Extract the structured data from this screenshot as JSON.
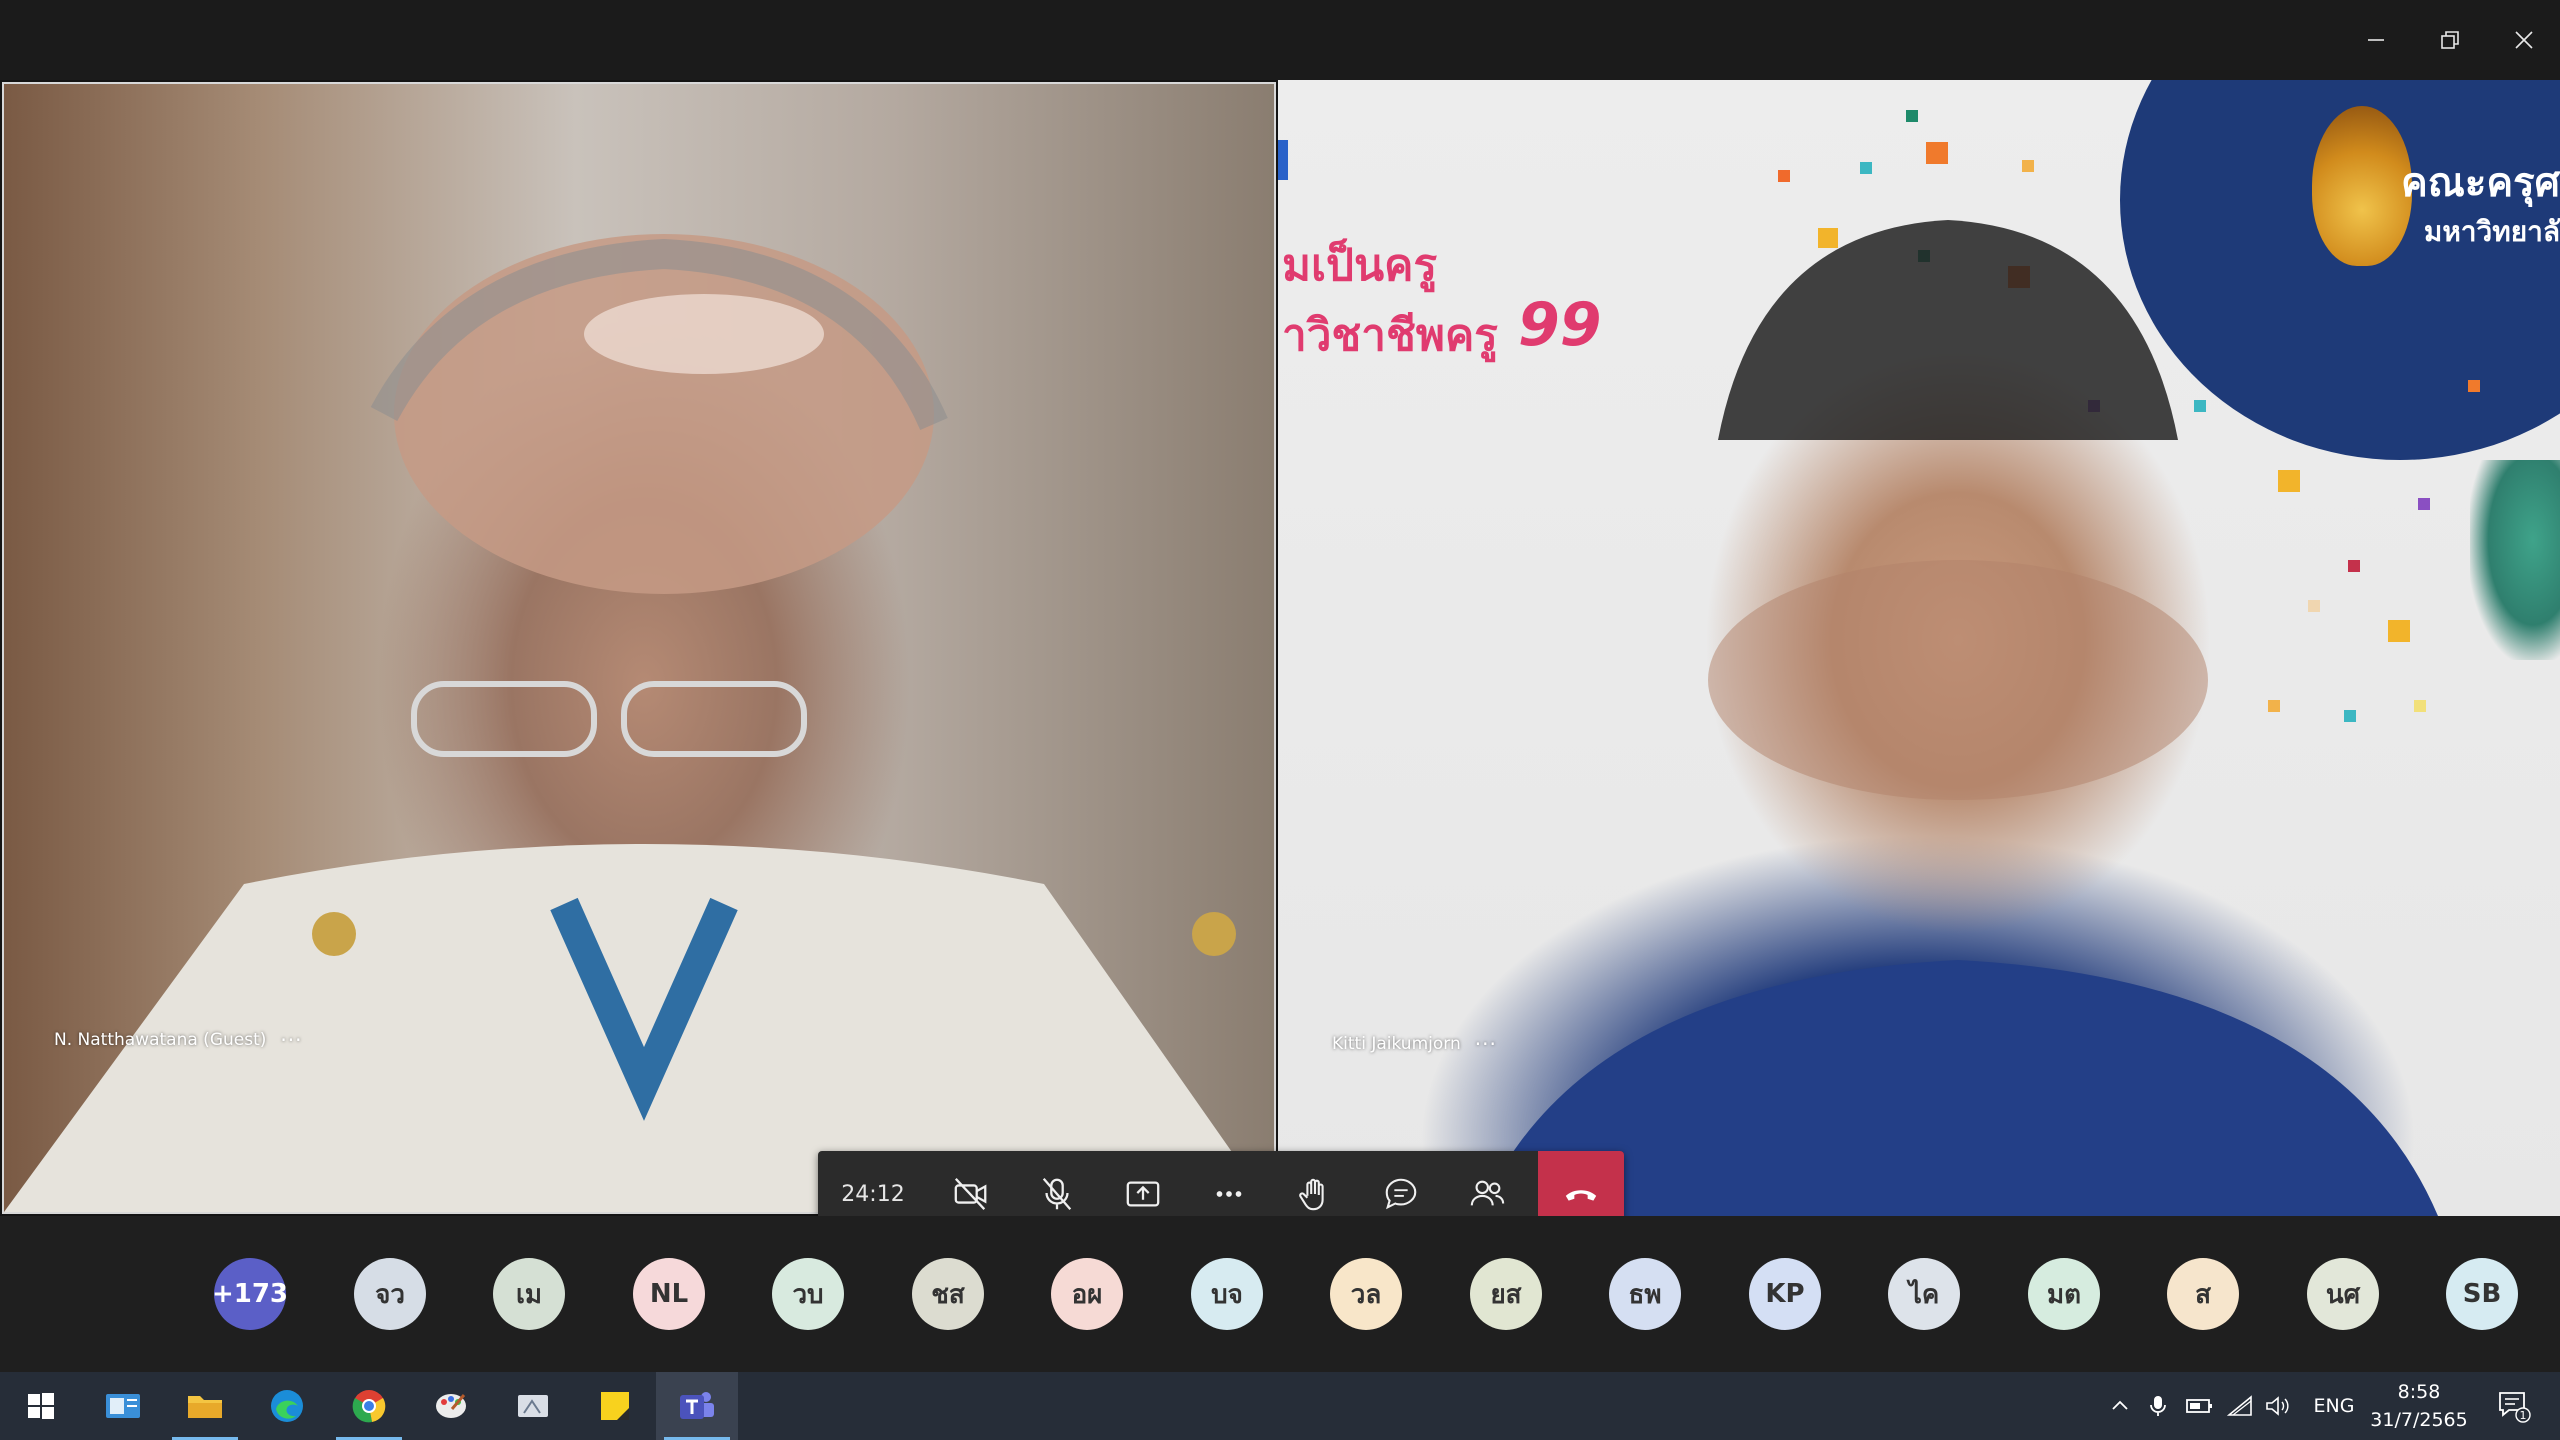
{
  "window": {
    "controls": [
      "minimize",
      "restore",
      "close"
    ]
  },
  "participants_video": [
    {
      "name": "N. Natthawatana (Guest)",
      "more": "···"
    },
    {
      "name": "Kitti Jaikumjorn",
      "more": "···"
    }
  ],
  "background_banner": {
    "line1": "มเป็นครู",
    "line2": "าวิชาชีพครู",
    "quote_mark": "99",
    "logo_line1": "คณะครุศ",
    "logo_line2": "มหาวิทยาลั"
  },
  "call_controls": {
    "timer": "24:12",
    "buttons": [
      "camera-off",
      "mic-off",
      "share-screen",
      "more-actions",
      "raise-hand",
      "chat",
      "participants",
      "leave"
    ]
  },
  "participant_avatars": [
    {
      "initials": "+173",
      "color": "#5b5fc7",
      "text_color": "#ffffff"
    },
    {
      "initials": "จว",
      "color": "#d6dde6"
    },
    {
      "initials": "เม",
      "color": "#d5e0d4"
    },
    {
      "initials": "NL",
      "color": "#f6d9da"
    },
    {
      "initials": "วบ",
      "color": "#d8eadf"
    },
    {
      "initials": "ชส",
      "color": "#dcdcd0"
    },
    {
      "initials": "อผ",
      "color": "#f6dad5"
    },
    {
      "initials": "บจ",
      "color": "#d7ebf1"
    },
    {
      "initials": "วล",
      "color": "#f8e6c9"
    },
    {
      "initials": "ยส",
      "color": "#e1e6d2"
    },
    {
      "initials": "ธพ",
      "color": "#d5dff2"
    },
    {
      "initials": "KP",
      "color": "#d4dff4"
    },
    {
      "initials": "ไค",
      "color": "#dde3ea"
    },
    {
      "initials": "มต",
      "color": "#d6ecdf"
    },
    {
      "initials": "ส",
      "color": "#f6e5cc"
    },
    {
      "initials": "นศ",
      "color": "#e2e7d9"
    },
    {
      "initials": "SB",
      "color": "#d6ebf2"
    }
  ],
  "taskbar": {
    "apps": [
      "start",
      "outlook",
      "file-explorer",
      "edge",
      "chrome",
      "paint",
      "snipping",
      "sticky-notes",
      "teams"
    ],
    "language": "ENG",
    "time": "8:58",
    "date": "31/7/2565",
    "notification_count": "1"
  }
}
